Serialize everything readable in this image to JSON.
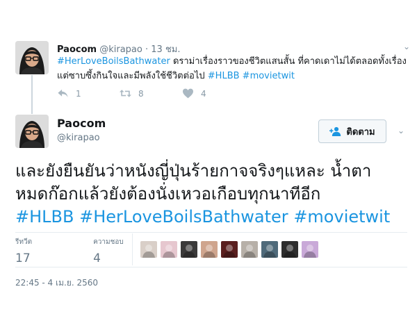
{
  "parent_tweet": {
    "name": "Paocom",
    "handle": "@kirapao",
    "separator": "·",
    "time": "13 ชม.",
    "text_line1_parts": [
      {
        "text": "#HerLoveBoilsBathwater",
        "kind": "hashtag"
      },
      {
        "text": " ดราม่าเรื่องราวของชีวิตแสนสั้น ที่คาดเดาไม่ได้ตลอดทั้งเรื่อง",
        "kind": "text"
      }
    ],
    "text_line2_parts": [
      {
        "text": "แต่ซาบซึ้งกินใจและมีพลังใช้ชีวิตต่อไป ",
        "kind": "text"
      },
      {
        "text": "#HLBB",
        "kind": "hashtag"
      },
      {
        "text": " ",
        "kind": "text"
      },
      {
        "text": "#movietwit",
        "kind": "hashtag"
      }
    ],
    "reply_count": "1",
    "retweet_count": "8",
    "like_count": "4",
    "reply_icon": "reply-icon",
    "retweet_icon": "retweet-icon",
    "like_icon": "heart-icon",
    "menu_icon": "chevron-down-icon"
  },
  "main_tweet": {
    "name": "Paocom",
    "handle": "@kirapao",
    "follow_label": "ติดตาม",
    "follow_icon": "add-user-icon",
    "menu_icon": "chevron-down-icon",
    "text_line1": "และยังยืนยันว่าหนังญี่ปุ่นร้ายกาจจริงๆแหละ น้ำตา",
    "text_line2": "หมดก๊อกแล้วยังต้องนั่งเหวอเกือบทุกนาทีอีก",
    "hashtags": [
      "#HLBB",
      "#HerLoveBoilsBathwater",
      "#movietwit"
    ],
    "retweets_label": "รีทวีต",
    "retweets_value": "17",
    "likes_label": "ความชอบ",
    "likes_value": "4",
    "likers_count": 9,
    "timestamp": "22:45 - 4 เม.ย. 2560"
  },
  "colors": {
    "link": "#1b95e0",
    "text": "#14171a",
    "secondary": "#657786",
    "divider": "#e6ecf0"
  }
}
